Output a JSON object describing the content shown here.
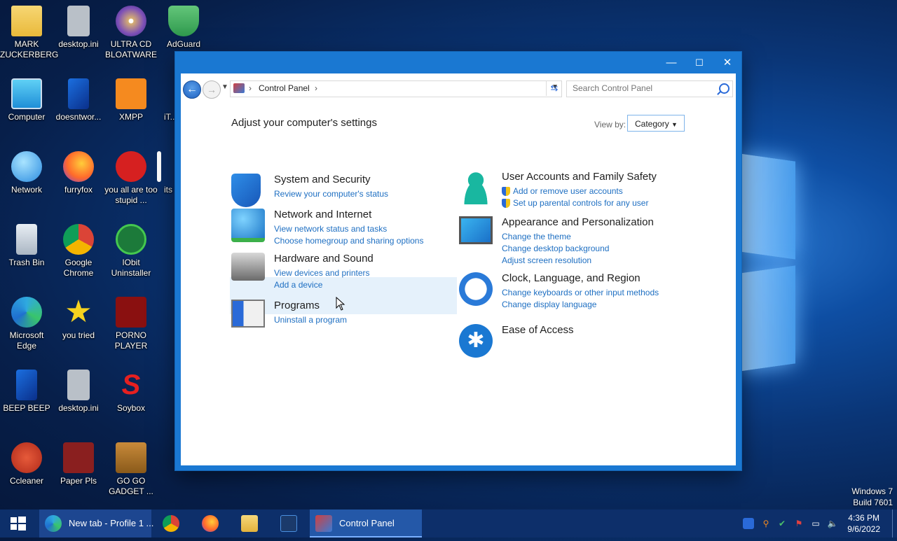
{
  "desktop": {
    "icons": [
      {
        "label": "MARK ZUCKERBERG",
        "icon": "folder-icon"
      },
      {
        "label": "desktop.ini",
        "icon": "settings-file-icon"
      },
      {
        "label": "ULTRA CD BLOATWARE",
        "icon": "disc-icon"
      },
      {
        "label": "AdGuard",
        "icon": "adguard-shield-icon"
      },
      {
        "label": "Computer",
        "icon": "computer-icon"
      },
      {
        "label": "doesntwor...",
        "icon": "file-icon"
      },
      {
        "label": "XMPP",
        "icon": "xampp-icon"
      },
      {
        "label": "iT...",
        "icon": "app-icon"
      },
      {
        "label": "Network",
        "icon": "network-icon"
      },
      {
        "label": "furryfox",
        "icon": "firefox-icon"
      },
      {
        "label": "you all are too stupid ...",
        "icon": "devcpp-icon"
      },
      {
        "label": "its",
        "icon": "file-icon"
      },
      {
        "label": "Trash Bin",
        "icon": "recycle-bin-icon"
      },
      {
        "label": "Google Chrome",
        "icon": "chrome-icon"
      },
      {
        "label": "IObit Uninstaller",
        "icon": "iobit-icon"
      },
      {
        "label": "Microsoft Edge",
        "icon": "edge-icon"
      },
      {
        "label": "you tried",
        "icon": "star-icon"
      },
      {
        "label": "PORNO PLAYER",
        "icon": "flash-icon"
      },
      {
        "label": "BEEP BEEP",
        "icon": "file-icon"
      },
      {
        "label": "desktop.ini",
        "icon": "settings-file-icon"
      },
      {
        "label": "Soybox",
        "icon": "soybox-icon"
      },
      {
        "label": "Ccleaner",
        "icon": "ccleaner-icon"
      },
      {
        "label": "Paper Pls",
        "icon": "paper-pls-icon"
      },
      {
        "label": "GO GO GADGET ...",
        "icon": "briefcase-icon"
      }
    ]
  },
  "window": {
    "title": "Control Panel",
    "controls": {
      "minimize": "—",
      "maximize": "☐",
      "close": "✕"
    },
    "address": {
      "crumb": "Control Panel",
      "sep": "›",
      "end_sep": "›"
    },
    "search_placeholder": "Search Control Panel",
    "heading": "Adjust your computer's settings",
    "view_by_label": "View by:",
    "view_by_value": "Category",
    "categories": [
      {
        "title": "System and Security",
        "links": [
          "Review your computer's status"
        ],
        "icon": "security-shield-icon"
      },
      {
        "title": "Network and Internet",
        "links": [
          "View network status and tasks",
          "Choose homegroup and sharing options"
        ],
        "icon": "network-globe-icon"
      },
      {
        "title": "Hardware and Sound",
        "links": [
          "View devices and printers",
          "Add a device"
        ],
        "icon": "printer-icon"
      },
      {
        "title": "Programs",
        "links": [
          "Uninstall a program"
        ],
        "icon": "programs-icon"
      },
      {
        "title": "User Accounts and Family Safety",
        "links": [
          "Add or remove user accounts",
          "Set up parental controls for any user"
        ],
        "icon": "user-icon"
      },
      {
        "title": "Appearance and Personalization",
        "links": [
          "Change the theme",
          "Change desktop background",
          "Adjust screen resolution"
        ],
        "icon": "monitor-icon"
      },
      {
        "title": "Clock, Language, and Region",
        "links": [
          "Change keyboards or other input methods",
          "Change display language"
        ],
        "icon": "clock-icon"
      },
      {
        "title": "Ease of Access",
        "links": [],
        "icon": "accessibility-icon"
      }
    ]
  },
  "taskbar": {
    "items": [
      {
        "label": "New tab - Profile 1 ...",
        "icon": "edge-icon"
      },
      {
        "label": "Control Panel",
        "icon": "control-panel-icon"
      }
    ],
    "time": "4:36 PM",
    "date": "9/6/2022"
  },
  "watermark": {
    "line1": "Windows 7",
    "line2": "Build 7601"
  }
}
